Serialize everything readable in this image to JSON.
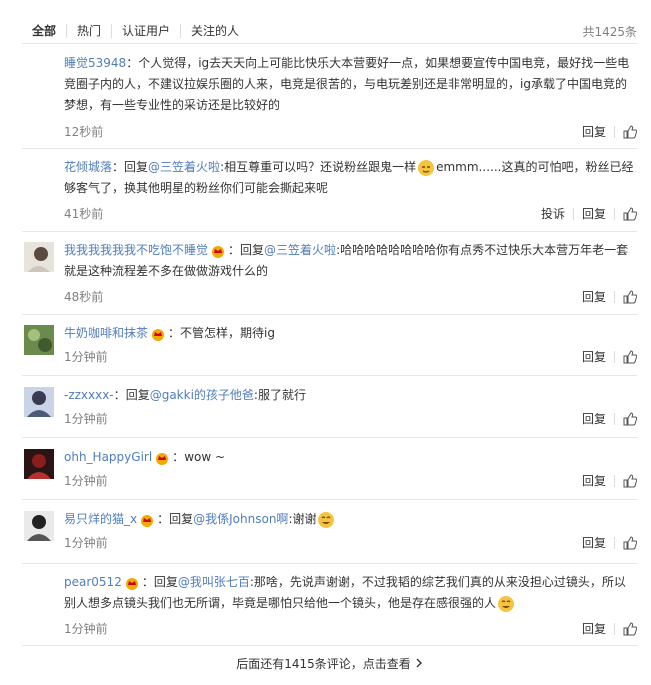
{
  "tabs": [
    "全部",
    "热门",
    "认证用户",
    "关注的人"
  ],
  "total": "共1425条",
  "actions": {
    "reply": "回复",
    "report": "投诉"
  },
  "comments": [
    {
      "user": "睡觉53948",
      "sep": "：",
      "text": "个人觉得，ig去天天向上可能比快乐大本营要好一点，如果想要宣传中国电竞，最好找一些电竞圈子内的人，不建议拉娱乐圈的人来，电竞是很苦的，与电玩差别还是非常明显的，ig承载了中国电竞的梦想，有一些专业性的采访还是比较好的",
      "time": "12秒前"
    },
    {
      "user": "花倾城落",
      "sep": "：",
      "reply_prefix": "回复",
      "mention": "@三笠着火啦",
      "text": ":相互尊重可以吗？还说粉丝跟鬼一样",
      "text2": "emmm......这真的可怕吧，粉丝已经够客气了，换其他明星的粉丝你们可能会撕起来呢",
      "time": "41秒前"
    },
    {
      "user": "我我我我我我不吃饱不睡觉",
      "sep": "：",
      "reply_prefix": "回复",
      "mention": "@三笠着火啦",
      "text": ":哈哈哈哈哈哈哈哈你有点秀不过快乐大本营万年老一套就是这种流程差不多在做做游戏什么的",
      "time": "48秒前"
    },
    {
      "user": "牛奶咖啡和抹茶",
      "sep": "：",
      "text": "不管怎样，期待ig",
      "time": "1分钟前"
    },
    {
      "user": "-zzxxxx-",
      "sep": "：",
      "reply_prefix": "回复",
      "mention": "@gakki的孩子他爸",
      "text": ":服了就行",
      "time": "1分钟前"
    },
    {
      "user": "ohh_HappyGirl",
      "sep": "：",
      "text": "wow ~",
      "time": "1分钟前"
    },
    {
      "user": "易只烊的猫_x",
      "sep": "：",
      "reply_prefix": "回复",
      "mention": "@我係Johnson啊",
      "text": ":谢谢",
      "time": "1分钟前"
    },
    {
      "user": "pear0512",
      "sep": "：",
      "reply_prefix": "回复",
      "mention": "@我叫张七百",
      "text": ":那啥，先说声谢谢，不过我韬的综艺我们真的从来没担心过镜头，所以别人想多点镜头我们也无所谓，毕竟是哪怕只给他一个镜头，他是存在感很强的人",
      "time": "1分钟前"
    }
  ],
  "footer": "后面还有1415条评论，点击查看",
  "colors": {
    "link": "#507dbc",
    "muted": "#808080",
    "rule": "#e6e6e6"
  }
}
